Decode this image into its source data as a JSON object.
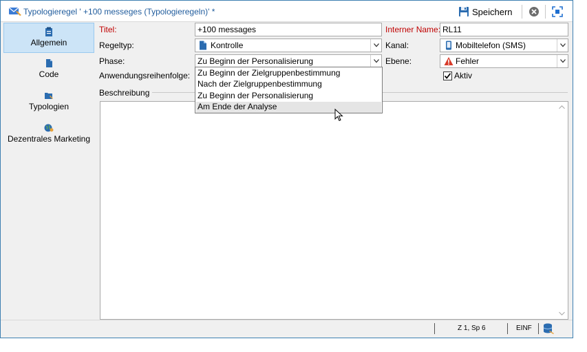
{
  "window": {
    "title": "Typologieregel ' +100 messeges (Typologieregeln)' *",
    "accent_color": "#1f5b9c",
    "toolbar": {
      "save_label": "Speichern",
      "save_icon": "floppy-disk-icon",
      "cancel_icon": "close-circle-icon",
      "maximize_icon": "maximize-icon"
    }
  },
  "sidebar": {
    "items": [
      {
        "label": "Allgemein",
        "icon": "clipboard-icon",
        "active": true
      },
      {
        "label": "Code",
        "icon": "document-icon",
        "active": false
      },
      {
        "label": "Typologien",
        "icon": "folder-icon",
        "active": false
      },
      {
        "label": "Dezentrales Marketing",
        "icon": "globe-user-icon",
        "active": false
      }
    ]
  },
  "form": {
    "title_label": "Titel:",
    "title_value": "+100 messages",
    "internal_name_label": "Interner Name:",
    "internal_name_value": "RL11",
    "rule_type_label": "Regeltyp:",
    "rule_type_value": "Kontrolle",
    "channel_label": "Kanal:",
    "channel_value": "Mobiltelefon (SMS)",
    "phase_label": "Phase:",
    "phase_value": "Zu Beginn der Personalisierung",
    "level_label": "Ebene:",
    "level_value": "Fehler",
    "order_label": "Anwendungsreihenfolge:",
    "active_label": "Aktiv",
    "active_checked": true,
    "description_label": "Beschreibung",
    "description_value": ""
  },
  "phase_dropdown": {
    "options": [
      "Zu Beginn der Zielgruppenbestimmung",
      "Nach der Zielgruppenbestimmung",
      "Zu Beginn der Personalisierung",
      "Am Ende der Analyse"
    ],
    "hovered_index": 3
  },
  "statusbar": {
    "position": "Z 1, Sp 6",
    "mode": "EINF"
  }
}
